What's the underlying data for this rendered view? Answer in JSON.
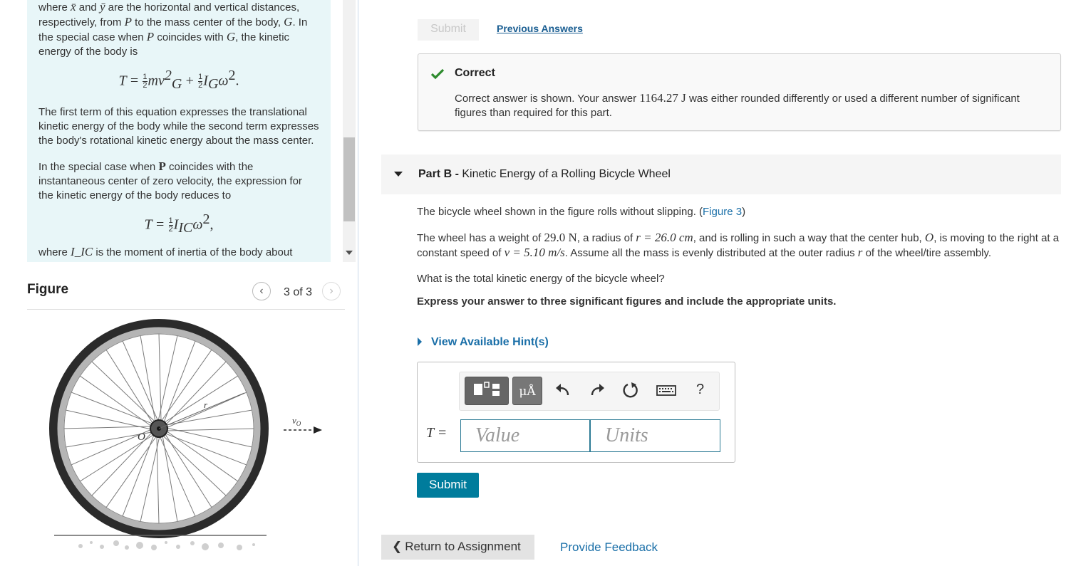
{
  "intro": {
    "p1": [
      "where ",
      "x̄",
      " and ",
      "ȳ",
      " are the horizontal and vertical distances, respectively, from ",
      "P",
      " to the mass center of the body, ",
      "G",
      ". In the special case when ",
      "P",
      " coincides with ",
      "G",
      ", the kinetic energy of the body is"
    ],
    "eq1": "T = ½mv_G² + ½I_Gω²",
    "p2": "The first term of this equation expresses the translational kinetic energy of the body while the second term expresses the body's rotational kinetic energy about the mass center.",
    "p3": [
      "In the special case when ",
      "P",
      " coincides with the instantaneous center of zero velocity, the expression for the kinetic energy of the body reduces to"
    ],
    "eq2": "T = ½I_ICω²,",
    "p4": [
      "where ",
      "I_IC",
      " is the moment of inertia of the body about"
    ]
  },
  "figure": {
    "title": "Figure",
    "counter": "3 of 3",
    "labels": {
      "radius": "r",
      "center": "O",
      "velocity": "v_O"
    }
  },
  "partA": {
    "submit_label": "Submit",
    "previous_answers": "Previous Answers",
    "status_title": "Correct",
    "msg_before": "Correct answer is shown. Your answer ",
    "answer_value": "1164.27 J",
    "msg_after": " was either rounded differently or used a different number of significant figures than required for this part."
  },
  "partB": {
    "label": "Part B -",
    "title": " Kinetic Energy of a Rolling Bicycle Wheel",
    "intro": "The bicycle wheel shown in the figure rolls without slipping. (",
    "figure_link": "Figure 3",
    "intro_end": ")",
    "desc": [
      "The wheel has a weight of ",
      "29.0 N",
      ", a radius of ",
      "r = 26.0 cm",
      ", and is rolling in such a way that the center hub, ",
      "O",
      ", is moving to the right at a constant speed of ",
      "v = 5.10 m/s",
      ". Assume all the mass is evenly distributed at the outer radius ",
      "r",
      " of the wheel/tire assembly."
    ],
    "question": "What is the total kinetic energy of the bicycle wheel?",
    "instruction": "Express your answer to three significant figures and include the appropriate units.",
    "hint_link": "View Available Hint(s)",
    "answer_label": "T =",
    "value_placeholder": "Value",
    "units_placeholder": "Units",
    "mu_label": "μÅ",
    "help_label": "?",
    "submit_label": "Submit"
  },
  "footer": {
    "return_label": "Return to Assignment",
    "feedback_label": "Provide Feedback"
  }
}
